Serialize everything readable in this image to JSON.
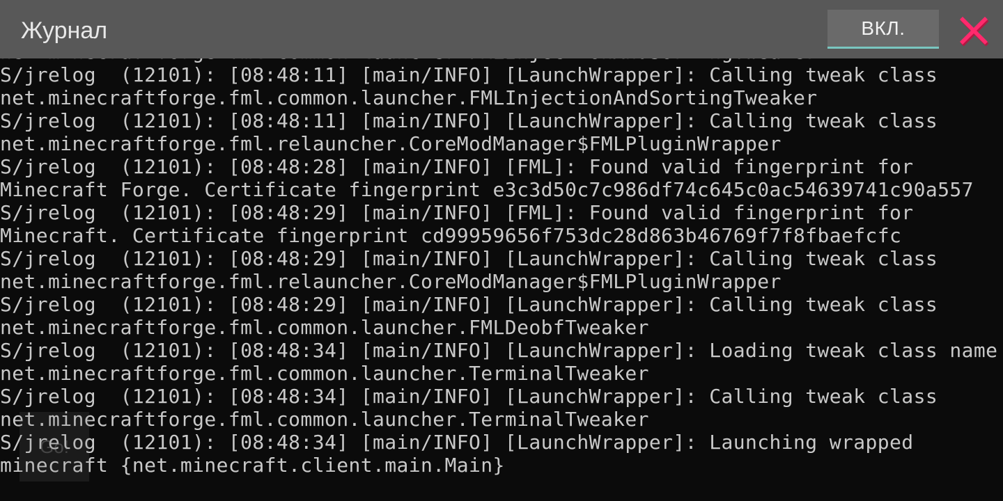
{
  "header": {
    "title": "Журнал",
    "toggle_label": "ВКЛ.",
    "close_icon": "close-x-icon",
    "accent_color": "#79c6c0",
    "close_color": "#ff2a6d"
  },
  "log": {
    "partial_top_line": "net.minecraftforge.fml.common.launcher.FMLInjectionAndSortingTweaker",
    "lines": [
      "S/jrelog  (12101): [08:48:11] [main/INFO] [LaunchWrapper]: Calling tweak class",
      "net.minecraftforge.fml.common.launcher.FMLInjectionAndSortingTweaker",
      "S/jrelog  (12101): [08:48:11] [main/INFO] [LaunchWrapper]: Calling tweak class",
      "net.minecraftforge.fml.relauncher.CoreModManager$FMLPluginWrapper",
      "S/jrelog  (12101): [08:48:28] [main/INFO] [FML]: Found valid fingerprint for",
      "Minecraft Forge. Certificate fingerprint e3c3d50c7c986df74c645c0ac54639741c90a557",
      "S/jrelog  (12101): [08:48:29] [main/INFO] [FML]: Found valid fingerprint for",
      "Minecraft. Certificate fingerprint cd99959656f753dc28d863b46769f7f8fbaefcfc",
      "S/jrelog  (12101): [08:48:29] [main/INFO] [LaunchWrapper]: Calling tweak class",
      "net.minecraftforge.fml.relauncher.CoreModManager$FMLPluginWrapper",
      "S/jrelog  (12101): [08:48:29] [main/INFO] [LaunchWrapper]: Calling tweak class",
      "net.minecraftforge.fml.common.launcher.FMLDeobfTweaker",
      "S/jrelog  (12101): [08:48:34] [main/INFO] [LaunchWrapper]: Loading tweak class name",
      "net.minecraftforge.fml.common.launcher.TerminalTweaker",
      "S/jrelog  (12101): [08:48:34] [main/INFO] [LaunchWrapper]: Calling tweak class",
      "net.minecraftforge.fml.common.launcher.TerminalTweaker",
      "S/jrelog  (12101): [08:48:34] [main/INFO] [LaunchWrapper]: Launching wrapped",
      "minecraft {net.minecraft.client.main.Main}"
    ]
  },
  "overlay": {
    "go_label": "Go!"
  }
}
